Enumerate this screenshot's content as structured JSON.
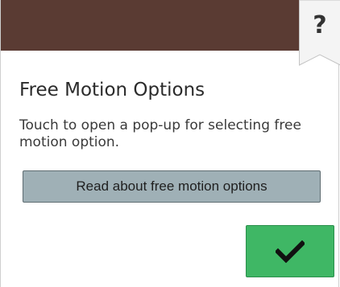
{
  "header": {
    "help_label": "?"
  },
  "content": {
    "title": "Free Motion Options",
    "description": "Touch to open a pop-up for selecting free motion option."
  },
  "actions": {
    "read_button_label": "Read about free motion options",
    "confirm_icon": "checkmark-icon"
  },
  "colors": {
    "title_bar": "#5a3b33",
    "read_button": "#9fb0b6",
    "confirm_button": "#3fb765"
  }
}
